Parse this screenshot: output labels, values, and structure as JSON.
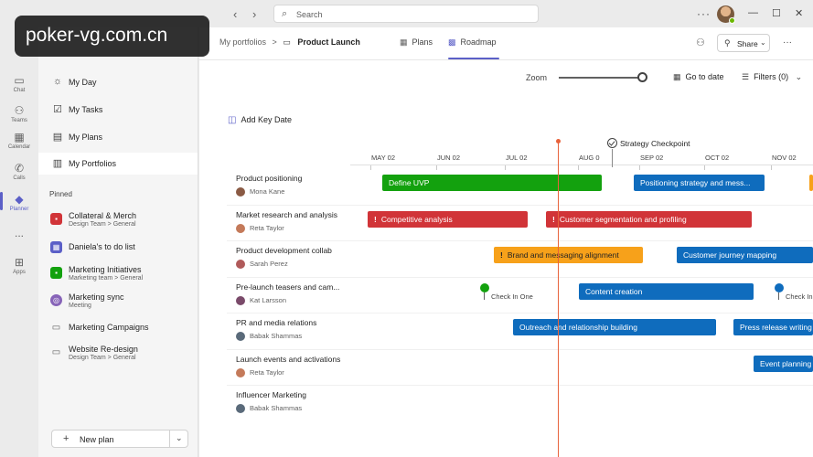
{
  "nav": {
    "back_icon": "chevron-left-icon",
    "forward_icon": "chevron-right-icon"
  },
  "search": {
    "placeholder": "Search"
  },
  "rail": {
    "items": [
      {
        "label": "Chat",
        "icon": "chat-icon"
      },
      {
        "label": "Teams",
        "icon": "teams-icon"
      },
      {
        "label": "Calendar",
        "icon": "calendar-icon"
      },
      {
        "label": "Calls",
        "icon": "calls-icon"
      },
      {
        "label": "Planner",
        "icon": "planner-icon"
      },
      {
        "label": "Apps",
        "icon": "apps-icon"
      }
    ],
    "more_label": "..."
  },
  "sidebar": {
    "items": [
      {
        "label": "My Day",
        "icon": "sun-icon"
      },
      {
        "label": "My Tasks",
        "icon": "task-icon"
      },
      {
        "label": "My Plans",
        "icon": "plans-icon"
      },
      {
        "label": "My Portfolios",
        "icon": "portfolio-icon"
      }
    ],
    "pinned_header": "Pinned",
    "pinned": [
      {
        "title": "Collateral & Merch",
        "subtitle": "Design Team > General",
        "color": "#d13438"
      },
      {
        "title": "Daniela's to do list",
        "subtitle": "",
        "color": "#5b5fc7"
      },
      {
        "title": "Marketing Initiatives",
        "subtitle": "Marketing team > General",
        "color": "#13a10e"
      },
      {
        "title": "Marketing sync",
        "subtitle": "Meeting",
        "color": "#8764b8"
      },
      {
        "title": "Marketing Campaigns",
        "subtitle": "",
        "color": "#616161"
      },
      {
        "title": "Website Re-design",
        "subtitle": "Design Team > General",
        "color": "#616161"
      }
    ],
    "new_plan_label": "New plan"
  },
  "header": {
    "crumb_root": "My portfolios",
    "crumb_sep": ">",
    "crumb_current": "Product Launch",
    "tabs": [
      {
        "label": "Plans",
        "icon": "grid-icon"
      },
      {
        "label": "Roadmap",
        "icon": "roadmap-icon"
      }
    ],
    "share_label": "Share"
  },
  "toolbar": {
    "zoom_label": "Zoom",
    "go_to_date_label": "Go to date",
    "filters_label": "Filters (0)",
    "add_key_date_label": "Add Key Date"
  },
  "timeline": {
    "months": [
      "MAY 02",
      "JUN 02",
      "JUL 02",
      "AUG 0",
      "SEP 02",
      "OCT 02",
      "NOV 02"
    ],
    "milestone": "Strategy Checkpoint"
  },
  "rows": [
    {
      "title": "Product positioning",
      "owner": "Mona Kane",
      "avatar_color": "#8a5a44",
      "bars": [
        {
          "label": "Define UVP",
          "color": "green",
          "flag": false
        },
        {
          "label": "Positioning strategy and mess...",
          "color": "blue",
          "flag": false
        }
      ]
    },
    {
      "title": "Market research and analysis",
      "owner": "Reta Taylor",
      "avatar_color": "#c47a5a",
      "bars": [
        {
          "label": "Competitive analysis",
          "color": "red",
          "flag": true
        },
        {
          "label": "Customer segmentation and profiling",
          "color": "red",
          "flag": true
        }
      ]
    },
    {
      "title": "Product development collab",
      "owner": "Sarah Perez",
      "avatar_color": "#b05a5a",
      "bars": [
        {
          "label": "Brand and messaging alignment",
          "color": "orange",
          "flag": true
        },
        {
          "label": "Customer journey mapping",
          "color": "blue",
          "flag": false
        }
      ]
    },
    {
      "title": "Pre-launch teasers and cam...",
      "owner": "Kat Larsson",
      "avatar_color": "#7a4a6a",
      "bars": [
        {
          "label": "Content creation",
          "color": "blue",
          "flag": false
        }
      ],
      "pins": [
        {
          "label": "Check In One",
          "color": "#13a10e"
        },
        {
          "label": "Check In",
          "color": "#0f6cbd"
        }
      ]
    },
    {
      "title": "PR and media relations",
      "owner": "Babak Shammas",
      "avatar_color": "#5a6a7a",
      "bars": [
        {
          "label": "Outreach and relationship building",
          "color": "blue",
          "flag": false
        },
        {
          "label": "Press release writing",
          "color": "blue",
          "flag": false
        }
      ]
    },
    {
      "title": "Launch events and activations",
      "owner": "Reta Taylor",
      "avatar_color": "#c47a5a",
      "bars": [
        {
          "label": "Event planning",
          "color": "blue",
          "flag": false
        }
      ]
    },
    {
      "title": "Influencer Marketing",
      "owner": "Babak Shammas",
      "avatar_color": "#5a6a7a",
      "bars": []
    }
  ],
  "watermark": "poker-vg.com.cn"
}
